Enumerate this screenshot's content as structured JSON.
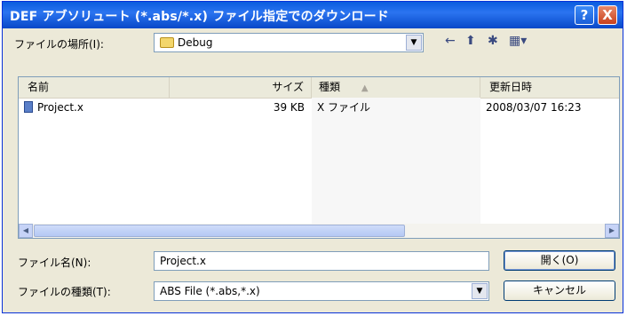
{
  "dialog": {
    "title": "DEF アブソリュート (*.abs/*.x) ファイル指定でのダウンロード",
    "help_glyph": "?",
    "close_glyph": "X"
  },
  "location": {
    "label": "ファイルの場所(I):",
    "value": "Debug"
  },
  "toolbar": {
    "back": "←",
    "up": "⬆",
    "new_folder": "✱",
    "views": "▦▾"
  },
  "list": {
    "columns": [
      "名前",
      "サイズ",
      "種類",
      "更新日時"
    ],
    "sort_indicator": "▲",
    "rows": [
      {
        "name": "Project.x",
        "size": "39 KB",
        "type": "X ファイル",
        "modified": "2008/03/07 16:23"
      }
    ]
  },
  "filename": {
    "label": "ファイル名(N):",
    "value": "Project.x"
  },
  "filetype": {
    "label": "ファイルの種類(T):",
    "value": "ABS File (*.abs,*.x)"
  },
  "buttons": {
    "open": "開く(O)",
    "cancel": "キャンセル"
  }
}
